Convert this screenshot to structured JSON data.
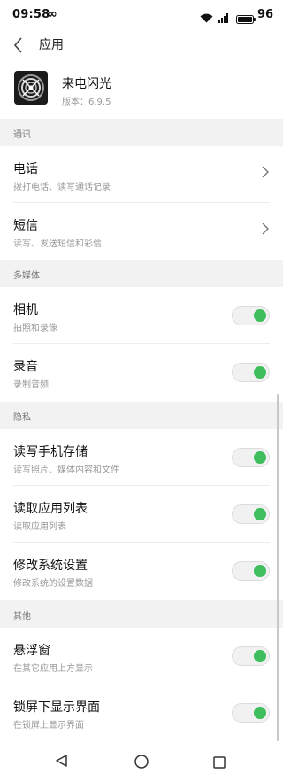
{
  "status_bar": {
    "time": "09:58",
    "infinity": "∞",
    "battery": "96",
    "icons": [
      "infinity-icon",
      "wifi-icon",
      "signal-icon",
      "battery-icon"
    ]
  },
  "header": {
    "title": "应用",
    "back_icon": "back-arrow-icon"
  },
  "app": {
    "name": "来电闪光",
    "version": "版本：6.9.5"
  },
  "sections": {
    "comms": "通讯",
    "media": "多媒体",
    "privacy": "隐私",
    "other": "其他"
  },
  "permissions": {
    "phone": {
      "title": "电话",
      "subtitle": "拨打电话、读写通话记录"
    },
    "sms": {
      "title": "短信",
      "subtitle": "读写、发送短信和彩信"
    },
    "camera": {
      "title": "相机",
      "subtitle": "拍照和录像",
      "enabled": true
    },
    "audio": {
      "title": "录音",
      "subtitle": "录制音频",
      "enabled": true
    },
    "storage": {
      "title": "读写手机存储",
      "subtitle": "读写照片、媒体内容和文件",
      "enabled": true
    },
    "app_list": {
      "title": "读取应用列表",
      "subtitle": "读取应用列表",
      "enabled": true
    },
    "system_settings": {
      "title": "修改系统设置",
      "subtitle": "修改系统的设置数据",
      "enabled": true
    },
    "overlay": {
      "title": "悬浮窗",
      "subtitle": "在其它应用上方显示",
      "enabled": true
    },
    "lockscreen": {
      "title": "锁屏下显示界面",
      "subtitle": "在锁屏上显示界面",
      "enabled": true
    }
  },
  "colors": {
    "toggle_on": "#3fbe5d",
    "section_bg": "#f2f2f2"
  },
  "nav_bar": {
    "icons": [
      "nav-back-icon",
      "nav-home-icon",
      "nav-recents-icon"
    ]
  }
}
